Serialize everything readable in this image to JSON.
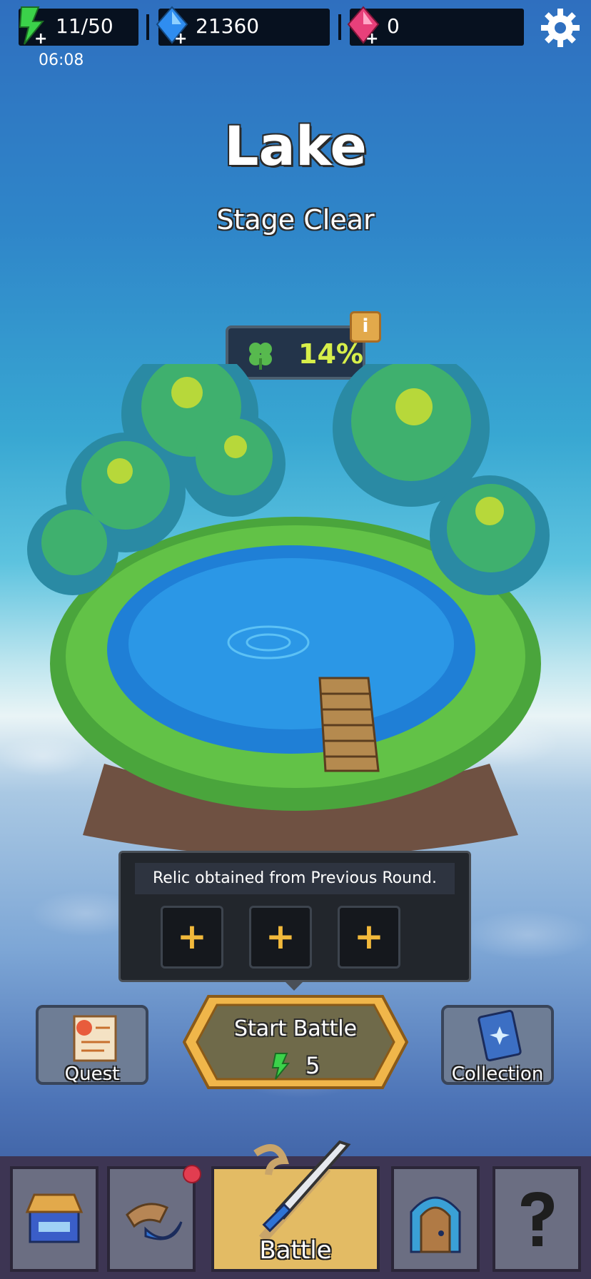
{
  "resources": {
    "energy": "11/50",
    "energy_timer": "06:08",
    "gems": "21360",
    "rubies": "0"
  },
  "stage": {
    "name": "Lake",
    "status": "Stage Clear",
    "luck_percent": "14%"
  },
  "relic_panel": {
    "title": "Relic obtained from Previous Round.",
    "slots": [
      "+",
      "+",
      "+"
    ]
  },
  "actions": {
    "quest_label": "Quest",
    "collection_label": "Collection",
    "start_label": "Start Battle",
    "start_cost": "5"
  },
  "nav": {
    "items": [
      {
        "icon": "shop-icon",
        "label": ""
      },
      {
        "icon": "equipment-icon",
        "label": ""
      },
      {
        "icon": "battle-icon",
        "label": "Battle"
      },
      {
        "icon": "door-icon",
        "label": ""
      },
      {
        "icon": "help-icon",
        "label": ""
      }
    ]
  },
  "colors": {
    "energy": "#3bd24a",
    "gem": "#2f8df0",
    "ruby": "#e8407a",
    "active_tab": "#e3bb64",
    "luck_text": "#d7ef4a"
  }
}
